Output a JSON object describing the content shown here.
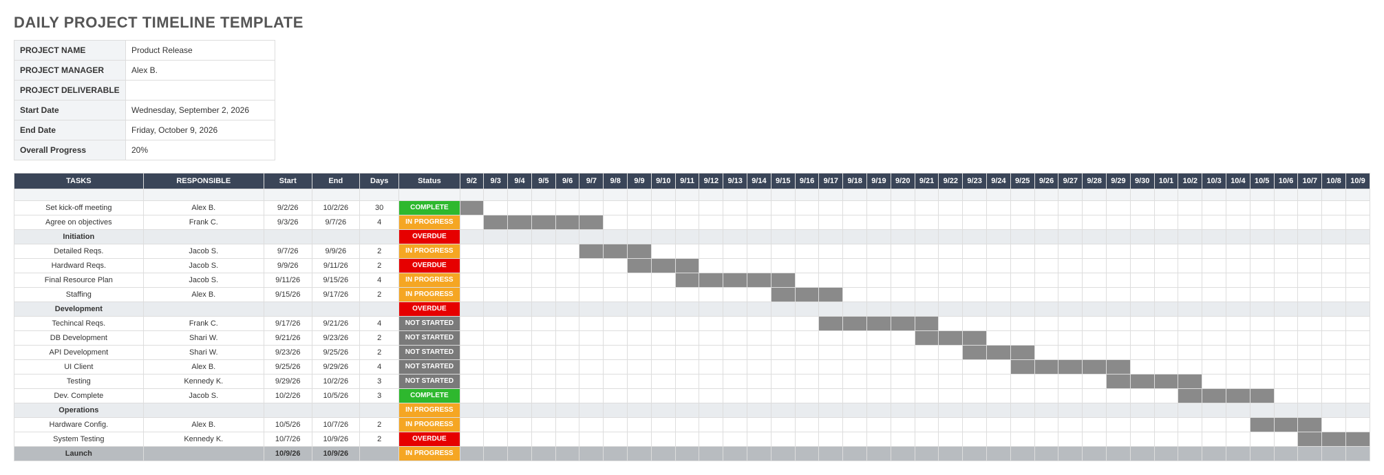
{
  "title": "DAILY PROJECT TIMELINE TEMPLATE",
  "meta": {
    "labels": {
      "project_name": "PROJECT NAME",
      "project_manager": "PROJECT MANAGER",
      "deliverable": "PROJECT DELIVERABLE",
      "start_date": "Start Date",
      "end_date": "End Date",
      "overall": "Overall Progress"
    },
    "values": {
      "project_name": "Product Release",
      "project_manager": "Alex B.",
      "deliverable": "",
      "start_date": "Wednesday, September 2, 2026",
      "end_date": "Friday, October 9, 2026",
      "overall": "20%"
    }
  },
  "headers": {
    "tasks": "TASKS",
    "responsible": "RESPONSIBLE",
    "start": "Start",
    "end": "End",
    "days": "Days",
    "status": "Status"
  },
  "status_labels": {
    "COMPLETE": "COMPLETE",
    "IN_PROGRESS": "IN PROGRESS",
    "OVERDUE": "OVERDUE",
    "NOT_STARTED": "NOT STARTED"
  },
  "dates": [
    "9/2",
    "9/3",
    "9/4",
    "9/5",
    "9/6",
    "9/7",
    "9/8",
    "9/9",
    "9/10",
    "9/11",
    "9/12",
    "9/13",
    "9/14",
    "9/15",
    "9/16",
    "9/17",
    "9/18",
    "9/19",
    "9/20",
    "9/21",
    "9/22",
    "9/23",
    "9/24",
    "9/25",
    "9/26",
    "9/27",
    "9/28",
    "9/29",
    "9/30",
    "10/1",
    "10/2",
    "10/3",
    "10/4",
    "10/5",
    "10/6",
    "10/7",
    "10/8",
    "10/9"
  ],
  "rows": [
    {
      "type": "blank"
    },
    {
      "type": "task",
      "task": "Set kick-off meeting",
      "resp": "Alex B.",
      "start": "9/2/26",
      "end": "10/2/26",
      "days": "30",
      "status": "COMPLETE",
      "barStart": 0,
      "barEnd": 0
    },
    {
      "type": "task",
      "task": "Agree on objectives",
      "resp": "Frank C.",
      "start": "9/3/26",
      "end": "9/7/26",
      "days": "4",
      "status": "IN_PROGRESS",
      "barStart": 1,
      "barEnd": 5
    },
    {
      "type": "section",
      "task": "Initiation",
      "status": "OVERDUE"
    },
    {
      "type": "task",
      "task": "Detailed Reqs.",
      "resp": "Jacob S.",
      "start": "9/7/26",
      "end": "9/9/26",
      "days": "2",
      "status": "IN_PROGRESS",
      "barStart": 5,
      "barEnd": 7
    },
    {
      "type": "task",
      "task": "Hardward Reqs.",
      "resp": "Jacob S.",
      "start": "9/9/26",
      "end": "9/11/26",
      "days": "2",
      "status": "OVERDUE",
      "barStart": 7,
      "barEnd": 9
    },
    {
      "type": "task",
      "task": "Final Resource Plan",
      "resp": "Jacob S.",
      "start": "9/11/26",
      "end": "9/15/26",
      "days": "4",
      "status": "IN_PROGRESS",
      "barStart": 9,
      "barEnd": 13
    },
    {
      "type": "task",
      "task": "Staffing",
      "resp": "Alex B.",
      "start": "9/15/26",
      "end": "9/17/26",
      "days": "2",
      "status": "IN_PROGRESS",
      "barStart": 13,
      "barEnd": 15
    },
    {
      "type": "section",
      "task": "Development",
      "status": "OVERDUE"
    },
    {
      "type": "task",
      "task": "Techincal Reqs.",
      "resp": "Frank C.",
      "start": "9/17/26",
      "end": "9/21/26",
      "days": "4",
      "status": "NOT_STARTED",
      "barStart": 15,
      "barEnd": 19
    },
    {
      "type": "task",
      "task": "DB Development",
      "resp": "Shari W.",
      "start": "9/21/26",
      "end": "9/23/26",
      "days": "2",
      "status": "NOT_STARTED",
      "barStart": 19,
      "barEnd": 21
    },
    {
      "type": "task",
      "task": "API Development",
      "resp": "Shari W.",
      "start": "9/23/26",
      "end": "9/25/26",
      "days": "2",
      "status": "NOT_STARTED",
      "barStart": 21,
      "barEnd": 23
    },
    {
      "type": "task",
      "task": "UI Client",
      "resp": "Alex B.",
      "start": "9/25/26",
      "end": "9/29/26",
      "days": "4",
      "status": "NOT_STARTED",
      "barStart": 23,
      "barEnd": 27
    },
    {
      "type": "task",
      "task": "Testing",
      "resp": "Kennedy K.",
      "start": "9/29/26",
      "end": "10/2/26",
      "days": "3",
      "status": "NOT_STARTED",
      "barStart": 27,
      "barEnd": 30
    },
    {
      "type": "task",
      "task": "Dev. Complete",
      "resp": "Jacob S.",
      "start": "10/2/26",
      "end": "10/5/26",
      "days": "3",
      "status": "COMPLETE",
      "barStart": 30,
      "barEnd": 33
    },
    {
      "type": "section",
      "task": "Operations",
      "status": "IN_PROGRESS"
    },
    {
      "type": "task",
      "task": "Hardware Config.",
      "resp": "Alex B.",
      "start": "10/5/26",
      "end": "10/7/26",
      "days": "2",
      "status": "IN_PROGRESS",
      "barStart": 33,
      "barEnd": 35
    },
    {
      "type": "task",
      "task": "System Testing",
      "resp": "Kennedy K.",
      "start": "10/7/26",
      "end": "10/9/26",
      "days": "2",
      "status": "OVERDUE",
      "barStart": 35,
      "barEnd": 37
    },
    {
      "type": "section-bold",
      "task": "Launch",
      "start": "10/9/26",
      "end": "10/9/26",
      "status": "IN_PROGRESS"
    }
  ]
}
